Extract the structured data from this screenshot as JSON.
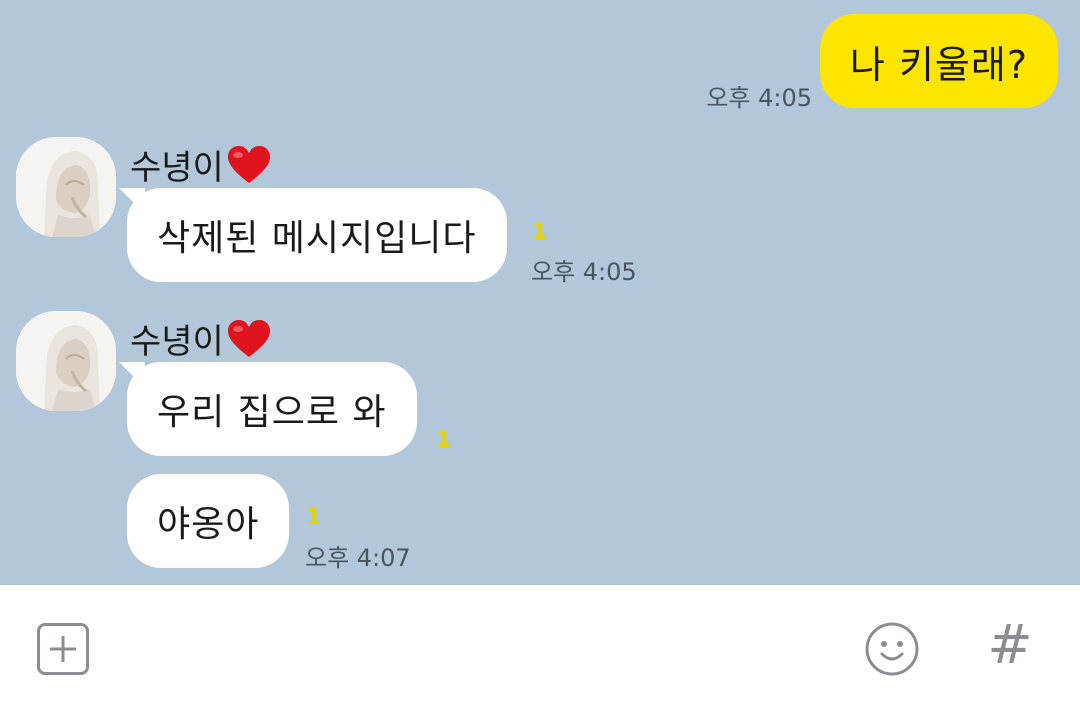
{
  "messages": {
    "sent_1": {
      "text": "나 키울래?",
      "time": "오후 4:05"
    },
    "received_1": {
      "sender": "수녕이",
      "text": "삭제된 메시지입니다",
      "unread": "1",
      "time": "오후 4:05"
    },
    "received_2": {
      "sender": "수녕이",
      "text": "우리 집으로 와",
      "unread": "1"
    },
    "received_3": {
      "text": "야옹아",
      "unread": "1",
      "time": "오후 4:07"
    }
  },
  "input_bar": {
    "hash_label": "#"
  },
  "colors": {
    "chat_background": "#b2c7d9",
    "sent_bubble": "#fee500",
    "received_bubble": "#ffffff",
    "unread_count": "#e8d200",
    "heart": "#e0141e"
  },
  "icons": {
    "sender_suffix": "heart-icon",
    "attach": "plus-icon",
    "emoji": "smiley-icon",
    "hashtag": "hash-icon"
  }
}
